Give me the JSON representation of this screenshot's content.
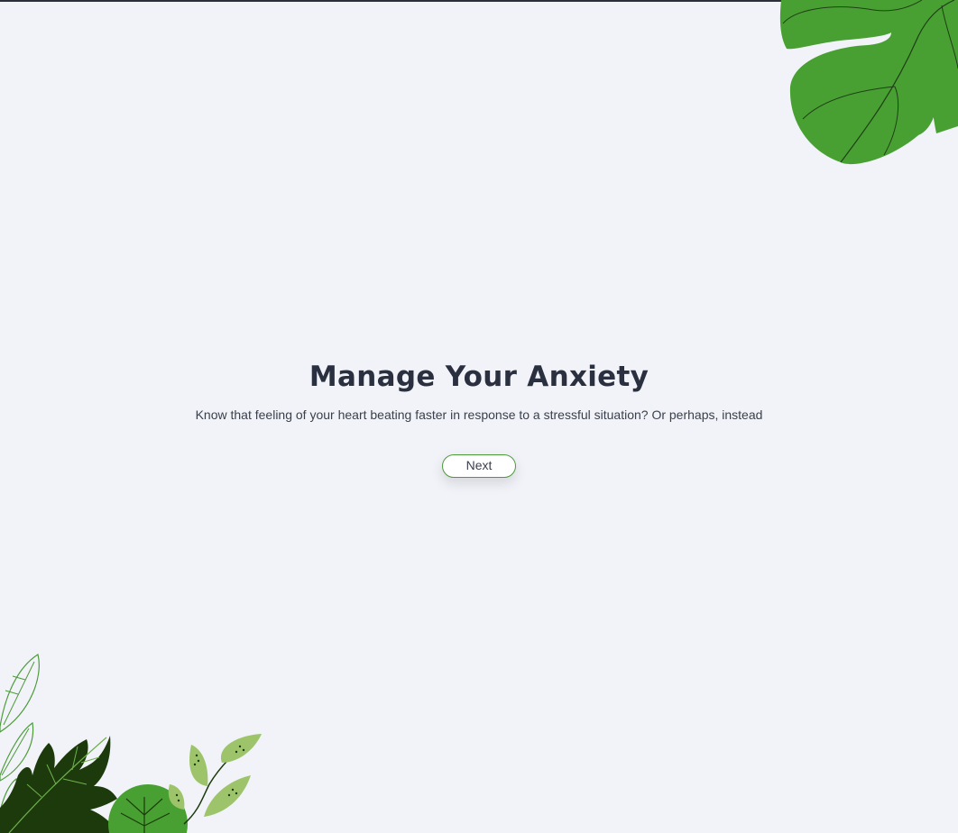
{
  "hero": {
    "title": "Manage Your Anxiety",
    "subtitle": "Know that feeling of your heart beating faster in response to a stressful situation? Or perhaps, instead",
    "next_label": "Next"
  },
  "decorations": {
    "top_right": "monstera-leaf-icon",
    "bottom_left": "plants-cluster-icon"
  },
  "colors": {
    "background": "#f1f3f8",
    "heading": "#2b3040",
    "accent_green": "#4c9b3a",
    "dark_green": "#1c3a0c",
    "light_green": "#9dc46a"
  }
}
